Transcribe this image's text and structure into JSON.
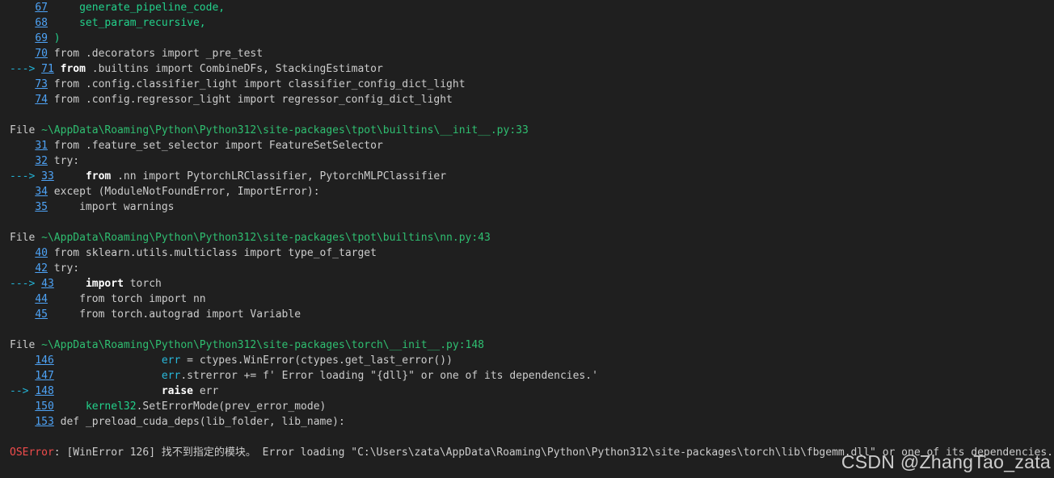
{
  "frames": [
    {
      "lines": [
        {
          "pre": "    ",
          "num": "67",
          "code": "    generate_pipeline_code,",
          "style": "green"
        },
        {
          "pre": "    ",
          "num": "68",
          "code": "    set_param_recursive,",
          "style": "green"
        },
        {
          "pre": "    ",
          "num": "69",
          "code": ")",
          "style": "green"
        },
        {
          "pre": "    ",
          "num": "70",
          "code": "from .decorators import _pre_test",
          "style": "plain"
        },
        {
          "pre": "---> ",
          "num": "71",
          "code": "from .builtins import CombineDFs, StackingEstimator",
          "style": "plain",
          "current": true,
          "bold_kw": "from",
          "rest": " .builtins import CombineDFs, StackingEstimator"
        },
        {
          "pre": "    ",
          "num": "73",
          "code": "from .config.classifier_light import classifier_config_dict_light",
          "style": "plain"
        },
        {
          "pre": "    ",
          "num": "74",
          "code": "from .config.regressor_light import regressor_config_dict_light",
          "style": "plain"
        }
      ]
    },
    {
      "file_label": "File ",
      "file_path": "~\\AppData\\Roaming\\Python\\Python312\\site-packages\\tpot\\builtins\\__init__.py:33",
      "lines": [
        {
          "pre": "    ",
          "num": "31",
          "code": "from .feature_set_selector import FeatureSetSelector",
          "style": "plain"
        },
        {
          "pre": "    ",
          "num": "32",
          "code": "try:",
          "style": "plain"
        },
        {
          "pre": "---> ",
          "num": "33",
          "code": "    from .nn import PytorchLRClassifier, PytorchMLPClassifier",
          "style": "plain",
          "current": true,
          "indent": "    ",
          "bold_kw": "from",
          "rest": " .nn import PytorchLRClassifier, PytorchMLPClassifier"
        },
        {
          "pre": "    ",
          "num": "34",
          "code": "except (ModuleNotFoundError, ImportError):",
          "style": "plain"
        },
        {
          "pre": "    ",
          "num": "35",
          "code": "    import warnings",
          "style": "plain"
        }
      ]
    },
    {
      "file_label": "File ",
      "file_path": "~\\AppData\\Roaming\\Python\\Python312\\site-packages\\tpot\\builtins\\nn.py:43",
      "lines": [
        {
          "pre": "    ",
          "num": "40",
          "code": "from sklearn.utils.multiclass import type_of_target",
          "style": "plain"
        },
        {
          "pre": "    ",
          "num": "42",
          "code": "try:",
          "style": "plain"
        },
        {
          "pre": "---> ",
          "num": "43",
          "code": "    import torch",
          "style": "plain",
          "current": true,
          "indent": "    ",
          "bold_kw": "import",
          "rest": " torch"
        },
        {
          "pre": "    ",
          "num": "44",
          "code": "    from torch import nn",
          "style": "plain"
        },
        {
          "pre": "    ",
          "num": "45",
          "code": "    from torch.autograd import Variable",
          "style": "plain"
        }
      ]
    },
    {
      "file_label": "File ",
      "file_path": "~\\AppData\\Roaming\\Python\\Python312\\site-packages\\torch\\__init__.py:148",
      "lines": [
        {
          "pre": "    ",
          "num": "146",
          "code": "                err = ctypes.WinError(ctypes.get_last_error())",
          "style": "err146"
        },
        {
          "pre": "    ",
          "num": "147",
          "code": "                err.strerror += f' Error loading \"{dll}\" or one of its dependencies.'",
          "style": "err147"
        },
        {
          "pre": "--> ",
          "num": "148",
          "code": "                raise err",
          "style": "plain",
          "current": true,
          "indent": "                ",
          "bold_kw": "raise",
          "rest": " err"
        },
        {
          "pre": "    ",
          "num": "150",
          "code": "    kernel32.SetErrorMode(prev_error_mode)",
          "style": "k32"
        },
        {
          "pre": "    ",
          "num": "153",
          "code": "def _preload_cuda_deps(lib_folder, lib_name):",
          "style": "plain"
        }
      ]
    }
  ],
  "error": {
    "name": "OSError",
    "message": ": [WinError 126] 找不到指定的模块。 Error loading \"C:\\Users\\zata\\AppData\\Roaming\\Python\\Python312\\site-packages\\torch\\lib\\fbgemm.dll\" or one of its dependencies."
  },
  "watermark": "CSDN @ZhangTao_zata",
  "colors": {
    "background": "#1f1f1f",
    "line_number": "#4ea3f6",
    "path": "#2fbf71",
    "error_name": "#f14c4c"
  }
}
